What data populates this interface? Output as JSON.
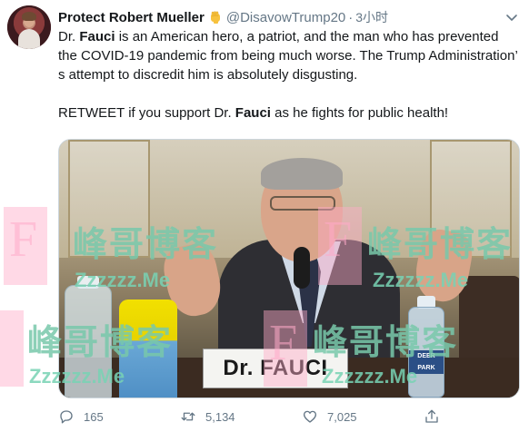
{
  "tweet": {
    "author_name": "Protect Robert Mueller",
    "author_emoji": "✊",
    "handle": "@DisavowTrump20",
    "separator": "·",
    "time": "3小时",
    "text": {
      "l1_pre": "Dr. ",
      "l1_bold": "Fauci",
      "l1_post": " is an American hero, a patriot, and the man who has prevented the COVID-19 pandemic from being much worse. The Trump Administration’ s attempt to discredit him is absolutely disgusting.",
      "l2_pre": "RETWEET if you support Dr. ",
      "l2_bold": "Fauci",
      "l2_post": " as he fights for public health!"
    },
    "media": {
      "placard_text": "Dr. FAUCI",
      "bottle_label": "DEER PARK"
    },
    "watermarks": {
      "letter": "F",
      "cn": "峰哥博客",
      "url": "Zzzzzz.Me"
    },
    "actions": {
      "replies": "165",
      "retweets": "5,134",
      "likes": "7,025"
    }
  },
  "colors": {
    "text": "#14171a",
    "secondary": "#657786",
    "border": "#ccd6dd"
  }
}
